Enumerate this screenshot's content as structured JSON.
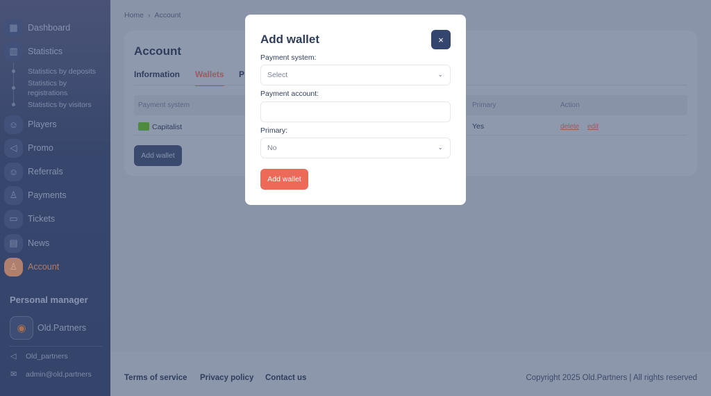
{
  "sidebar": {
    "items": [
      {
        "label": "Dashboard",
        "icon": "grid-icon"
      },
      {
        "label": "Statistics",
        "icon": "chart-icon"
      },
      {
        "label": "Players",
        "icon": "users-icon"
      },
      {
        "label": "Promo",
        "icon": "megaphone-icon"
      },
      {
        "label": "Referrals",
        "icon": "users-icon"
      },
      {
        "label": "Payments",
        "icon": "user-plus-icon"
      },
      {
        "label": "Tickets",
        "icon": "ticket-icon"
      },
      {
        "label": "News",
        "icon": "book-icon"
      },
      {
        "label": "Account",
        "icon": "user-icon"
      }
    ],
    "sub_items": [
      "Statistics by deposits",
      "Statistics by registrations",
      "Statistics by visitors"
    ],
    "personal_manager": {
      "title": "Personal manager",
      "name": "Old.Partners",
      "telegram": "Old_partners",
      "email": "admin@old.partners"
    }
  },
  "breadcrumb": {
    "home": "Home",
    "current": "Account"
  },
  "main": {
    "title": "Account",
    "tabs": [
      {
        "label": "Information"
      },
      {
        "label": "Wallets",
        "active": true
      },
      {
        "label": "P"
      }
    ],
    "table": {
      "headers": [
        "Payment system",
        "Primary",
        "Action"
      ],
      "rows": [
        {
          "payment_system": "Capitalist",
          "primary": "Yes",
          "actions": [
            "delete",
            "edit"
          ]
        }
      ]
    },
    "add_wallet_label": "Add wallet"
  },
  "footer": {
    "links": [
      "Terms of service",
      "Privacy policy",
      "Contact us"
    ],
    "copyright": "Copyright 2025 Old.Partners | All rights reserved"
  },
  "modal": {
    "title": "Add wallet",
    "close": "×",
    "payment_system_label": "Payment system:",
    "payment_system_value": "Select",
    "payment_account_label": "Payment account:",
    "payment_account_value": "",
    "primary_label": "Primary:",
    "primary_value": "No",
    "submit": "Add wallet"
  },
  "colors": {
    "accent": "#ec6a57",
    "primary_dark": "#34466e"
  }
}
